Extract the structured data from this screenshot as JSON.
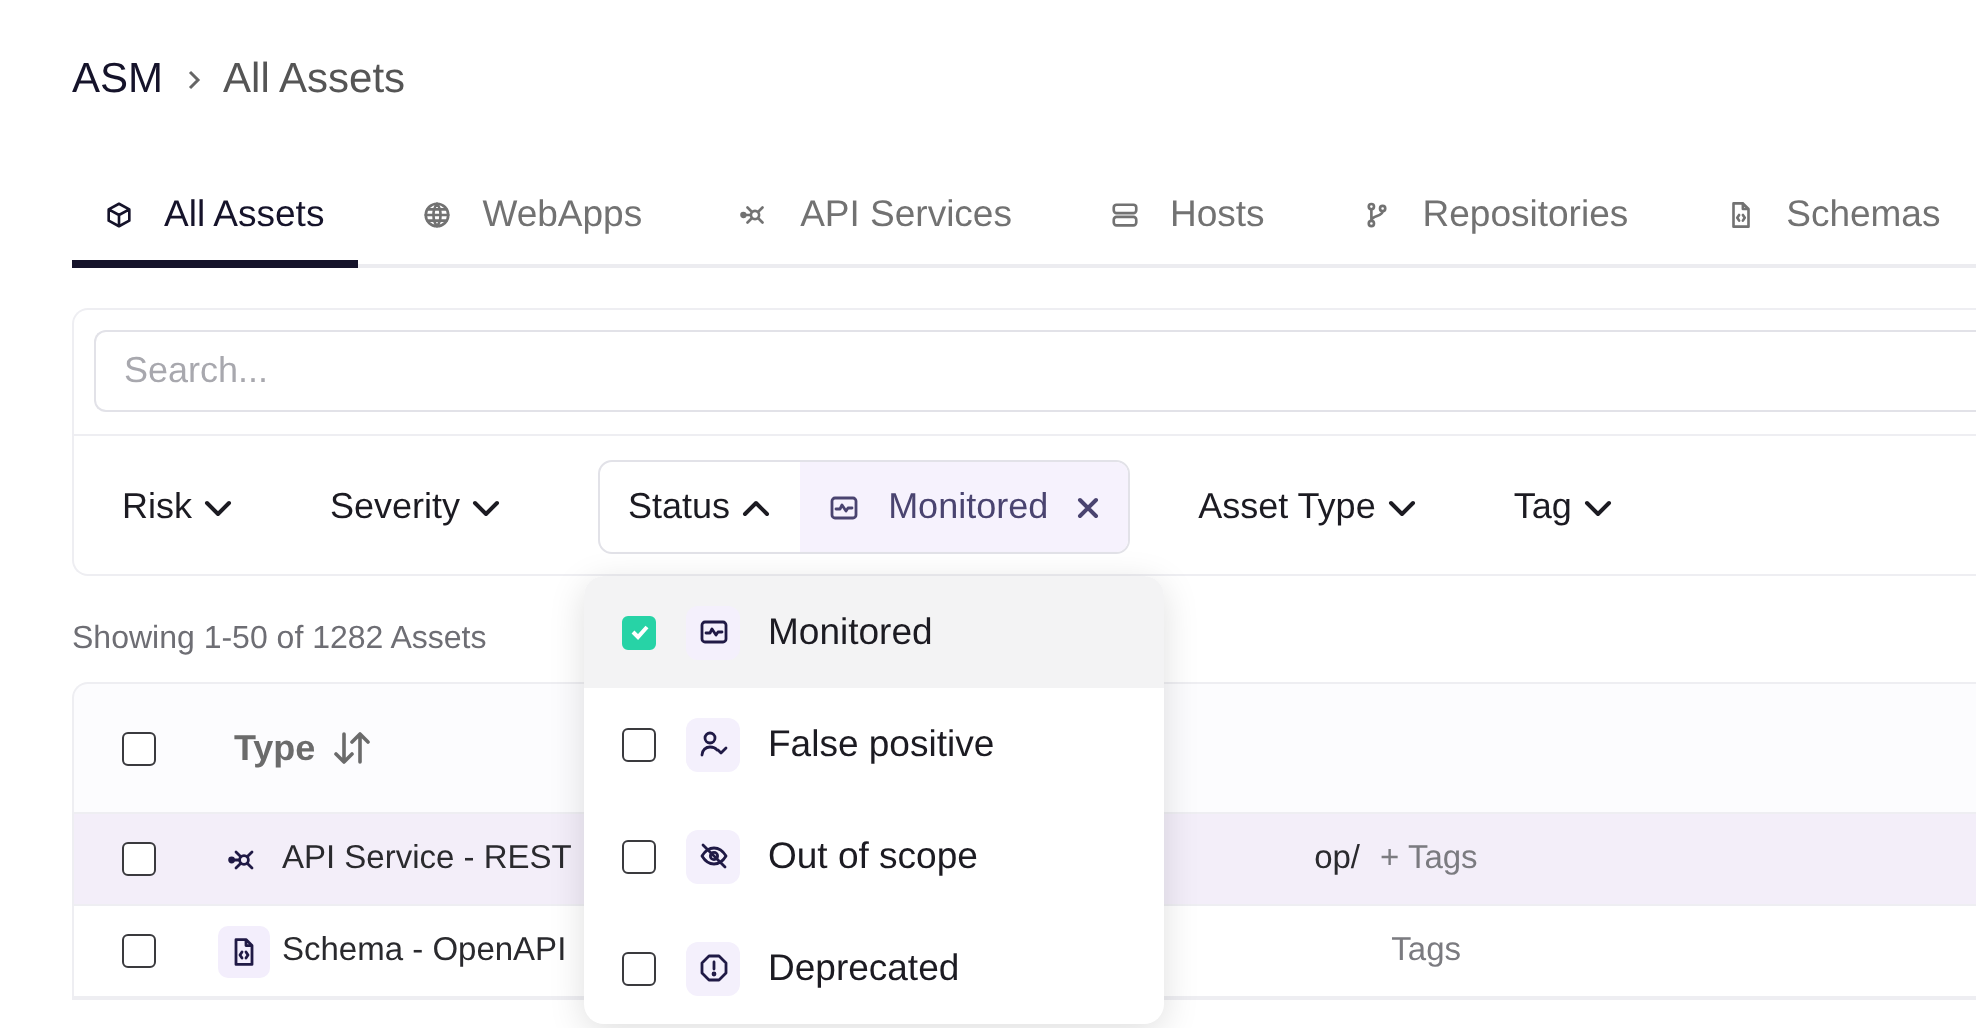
{
  "breadcrumb": [
    "ASM",
    "All Assets"
  ],
  "tabs": [
    {
      "label": "All Assets",
      "selected": true
    },
    {
      "label": "WebApps",
      "selected": false
    },
    {
      "label": "API Services",
      "selected": false
    },
    {
      "label": "Hosts",
      "selected": false
    },
    {
      "label": "Repositories",
      "selected": false
    },
    {
      "label": "Schemas",
      "selected": false
    }
  ],
  "search": {
    "placeholder": "Search..."
  },
  "filters": [
    {
      "label": "Risk",
      "expanded": false
    },
    {
      "label": "Severity",
      "expanded": false
    },
    {
      "label": "Status",
      "expanded": true,
      "chips": [
        "Monitored"
      ]
    },
    {
      "label": "Asset Type",
      "expanded": false
    },
    {
      "label": "Tag",
      "expanded": false
    }
  ],
  "result_count": "Showing 1-50 of 1282 Assets",
  "table": {
    "select_all": {
      "checked": false
    },
    "columns": [
      {
        "label": "Type"
      }
    ],
    "rows": [
      {
        "kind": "api",
        "checked": false,
        "highlighted": true,
        "type": "API Service - REST",
        "column_2": "op/",
        "tags": "+ Tags"
      },
      {
        "kind": "schema",
        "checked": false,
        "highlighted": false,
        "type": "Schema - OpenAPI",
        "tags": "Tags"
      }
    ]
  },
  "status_menu": [
    {
      "label": "Monitored",
      "checked": true,
      "selected": true
    },
    {
      "label": "False positive",
      "checked": false,
      "selected": false
    },
    {
      "label": "Out of scope",
      "checked": false,
      "selected": false
    },
    {
      "label": "Deprecated",
      "checked": false,
      "selected": false
    }
  ]
}
